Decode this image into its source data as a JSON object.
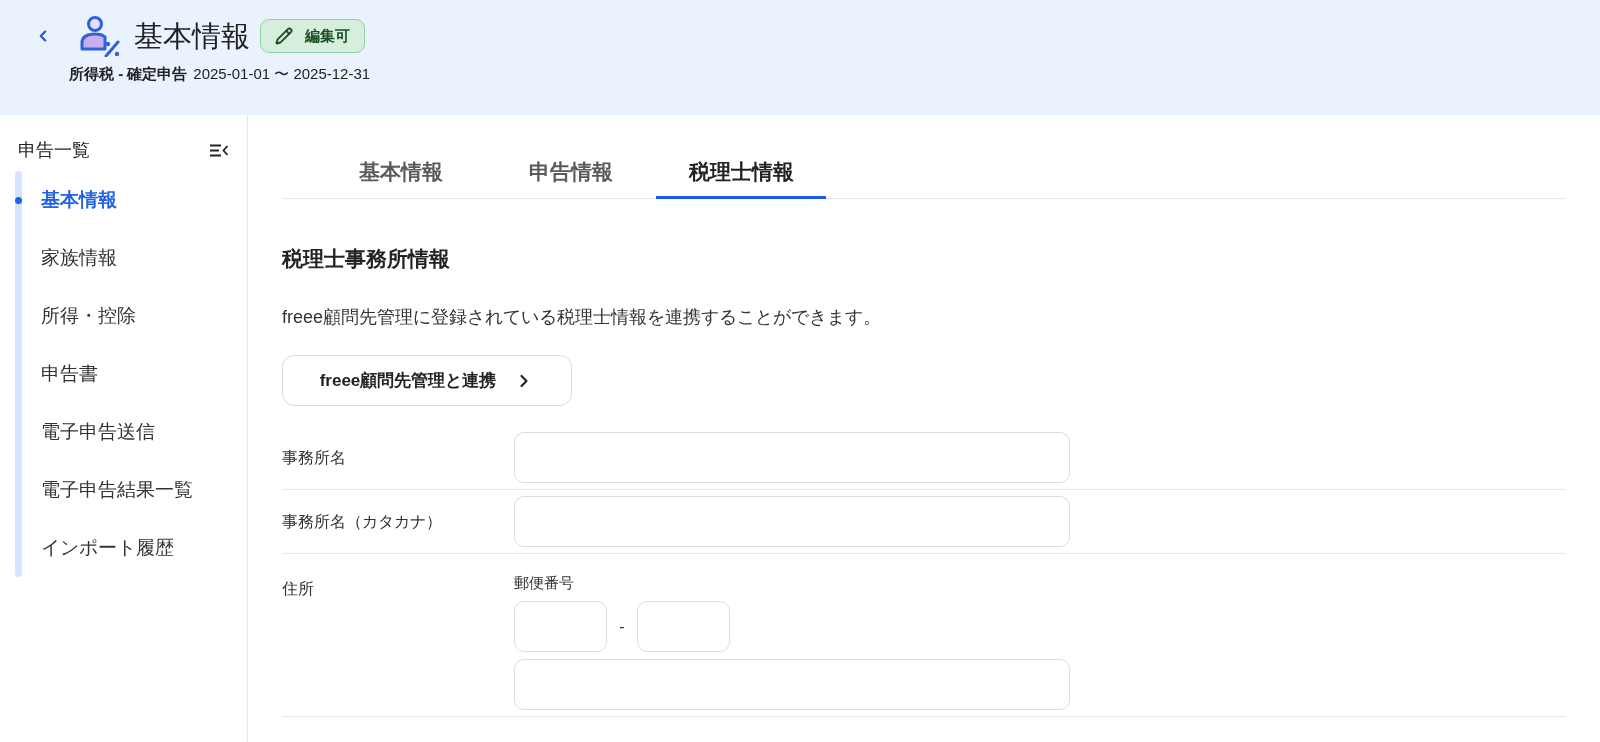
{
  "header": {
    "title": "基本情報",
    "badge": "編集可",
    "filing": "所得税 - 確定申告",
    "period": "2025-01-01 〜 2025-12-31"
  },
  "sidebar": {
    "title": "申告一覧",
    "items": [
      {
        "label": "基本情報",
        "selected": true
      },
      {
        "label": "家族情報",
        "selected": false
      },
      {
        "label": "所得・控除",
        "selected": false
      },
      {
        "label": "申告書",
        "selected": false
      },
      {
        "label": "電子申告送信",
        "selected": false
      },
      {
        "label": "電子申告結果一覧",
        "selected": false
      },
      {
        "label": "インポート履歴",
        "selected": false
      }
    ]
  },
  "tabs": [
    {
      "label": "基本情報",
      "selected": false
    },
    {
      "label": "申告情報",
      "selected": false
    },
    {
      "label": "税理士情報",
      "selected": true
    }
  ],
  "section": {
    "title": "税理士事務所情報",
    "description": "freee顧問先管理に登録されている税理士情報を連携することができます。",
    "link_button": "freee顧問先管理と連携"
  },
  "form": {
    "rows": [
      {
        "kind": "text",
        "label": "事務所名"
      },
      {
        "kind": "text",
        "label": "事務所名（カタカナ）"
      },
      {
        "kind": "address",
        "label": "住所",
        "postal_label": "郵便番号",
        "postal_separator": "-"
      }
    ]
  }
}
